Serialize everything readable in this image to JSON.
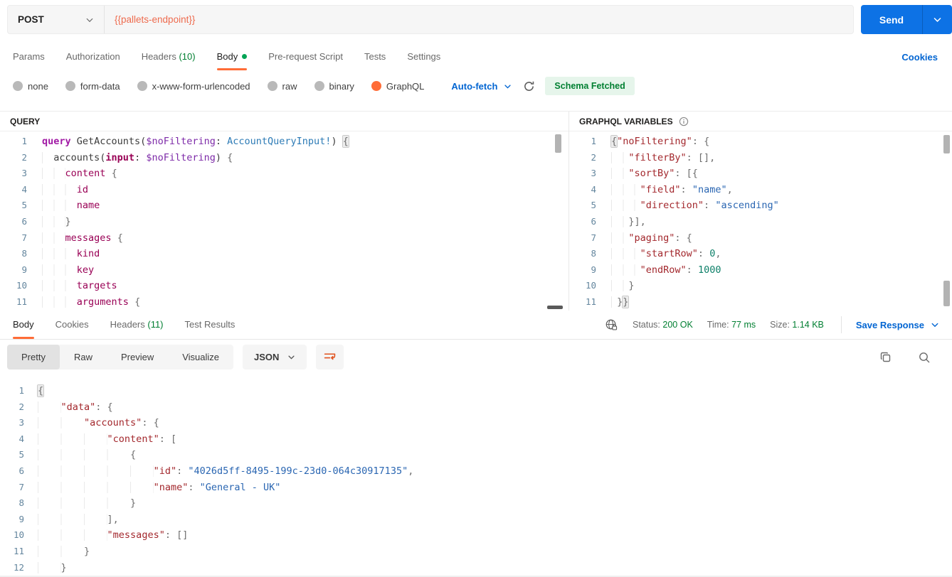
{
  "colors": {
    "accent_orange": "#FF6C37",
    "link_blue": "#0265D2",
    "send_blue": "#0D72E5",
    "status_green": "#007F31",
    "badge_green_bg": "#E6F5EB",
    "url_text": "#EE6B4E"
  },
  "request": {
    "method": "POST",
    "url": "{{pallets-endpoint}}",
    "send_label": "Send",
    "cookies_link": "Cookies",
    "tabs": [
      {
        "label": "Params"
      },
      {
        "label": "Authorization"
      },
      {
        "label": "Headers",
        "count": "(10)"
      },
      {
        "label": "Body",
        "active": true,
        "dot": true
      },
      {
        "label": "Pre-request Script"
      },
      {
        "label": "Tests"
      },
      {
        "label": "Settings"
      }
    ],
    "body_modes": [
      {
        "label": "none"
      },
      {
        "label": "form-data"
      },
      {
        "label": "x-www-form-urlencoded"
      },
      {
        "label": "raw"
      },
      {
        "label": "binary"
      },
      {
        "label": "GraphQL",
        "selected": true
      }
    ],
    "autofetch_label": "Auto-fetch",
    "schema_status": "Schema Fetched"
  },
  "query_panel": {
    "title": "QUERY",
    "lines": [
      [
        [
          "kw",
          "query"
        ],
        [
          "pl",
          " GetAccounts("
        ],
        [
          "vr",
          "$noFiltering"
        ],
        [
          "pl",
          ": "
        ],
        [
          "ty",
          "AccountQueryInput!"
        ],
        [
          "pl",
          ") "
        ],
        [
          "mb",
          "{"
        ]
      ],
      [
        [
          "in",
          "  "
        ],
        [
          "pl",
          "accounts("
        ],
        [
          "df",
          "input"
        ],
        [
          "pl",
          ": "
        ],
        [
          "vr",
          "$noFiltering"
        ],
        [
          "pl",
          ") "
        ],
        [
          "pc",
          "{"
        ]
      ],
      [
        [
          "in",
          "    "
        ],
        [
          "fd",
          "content"
        ],
        [
          "pl",
          " "
        ],
        [
          "pc",
          "{"
        ]
      ],
      [
        [
          "in",
          "      "
        ],
        [
          "fd",
          "id"
        ]
      ],
      [
        [
          "in",
          "      "
        ],
        [
          "fd",
          "name"
        ]
      ],
      [
        [
          "in",
          "    "
        ],
        [
          "pc",
          "}"
        ]
      ],
      [
        [
          "in",
          "    "
        ],
        [
          "fd",
          "messages"
        ],
        [
          "pl",
          " "
        ],
        [
          "pc",
          "{"
        ]
      ],
      [
        [
          "in",
          "      "
        ],
        [
          "fd",
          "kind"
        ]
      ],
      [
        [
          "in",
          "      "
        ],
        [
          "fd",
          "key"
        ]
      ],
      [
        [
          "in",
          "      "
        ],
        [
          "fd",
          "targets"
        ]
      ],
      [
        [
          "in",
          "      "
        ],
        [
          "fd",
          "arguments"
        ],
        [
          "pl",
          " "
        ],
        [
          "pc",
          "{"
        ]
      ]
    ]
  },
  "variables_panel": {
    "title": "GRAPHQL VARIABLES",
    "lines": [
      [
        [
          "mb",
          "{"
        ],
        [
          "ky",
          "\"noFiltering\""
        ],
        [
          "pc",
          ": {"
        ]
      ],
      [
        [
          "in",
          "   "
        ],
        [
          "ky",
          "\"filterBy\""
        ],
        [
          "pc",
          ": [],"
        ]
      ],
      [
        [
          "in",
          "   "
        ],
        [
          "ky",
          "\"sortBy\""
        ],
        [
          "pc",
          ": [{"
        ]
      ],
      [
        [
          "in",
          "     "
        ],
        [
          "ky",
          "\"field\""
        ],
        [
          "pc",
          ": "
        ],
        [
          "st",
          "\"name\""
        ],
        [
          "pc",
          ","
        ]
      ],
      [
        [
          "in",
          "     "
        ],
        [
          "ky",
          "\"direction\""
        ],
        [
          "pc",
          ": "
        ],
        [
          "st",
          "\"ascending\""
        ]
      ],
      [
        [
          "in",
          "   "
        ],
        [
          "pc",
          "}],"
        ]
      ],
      [
        [
          "in",
          "   "
        ],
        [
          "ky",
          "\"paging\""
        ],
        [
          "pc",
          ": {"
        ]
      ],
      [
        [
          "in",
          "     "
        ],
        [
          "ky",
          "\"startRow\""
        ],
        [
          "pc",
          ": "
        ],
        [
          "nm",
          "0"
        ],
        [
          "pc",
          ","
        ]
      ],
      [
        [
          "in",
          "     "
        ],
        [
          "ky",
          "\"endRow\""
        ],
        [
          "pc",
          ": "
        ],
        [
          "nm",
          "1000"
        ]
      ],
      [
        [
          "in",
          "   "
        ],
        [
          "pc",
          "}"
        ]
      ],
      [
        [
          "in",
          " "
        ],
        [
          "pc",
          "}"
        ],
        [
          "mb",
          "}"
        ]
      ]
    ]
  },
  "response": {
    "tabs": [
      {
        "label": "Body",
        "active": true
      },
      {
        "label": "Cookies"
      },
      {
        "label": "Headers",
        "count": "(11)"
      },
      {
        "label": "Test Results"
      }
    ],
    "status_label": "Status:",
    "status_value": "200 OK",
    "time_label": "Time:",
    "time_value": "77 ms",
    "size_label": "Size:",
    "size_value": "1.14 KB",
    "save_label": "Save Response",
    "view_tabs": [
      {
        "label": "Pretty",
        "active": true
      },
      {
        "label": "Raw"
      },
      {
        "label": "Preview"
      },
      {
        "label": "Visualize"
      }
    ],
    "language": "JSON",
    "body_lines": [
      [
        [
          "mb",
          "{"
        ]
      ],
      [
        [
          "in",
          "    "
        ],
        [
          "ky",
          "\"data\""
        ],
        [
          "pc",
          ": {"
        ]
      ],
      [
        [
          "in",
          "        "
        ],
        [
          "ky",
          "\"accounts\""
        ],
        [
          "pc",
          ": {"
        ]
      ],
      [
        [
          "in",
          "            "
        ],
        [
          "ky",
          "\"content\""
        ],
        [
          "pc",
          ": ["
        ]
      ],
      [
        [
          "in",
          "                "
        ],
        [
          "pc",
          "{"
        ]
      ],
      [
        [
          "in",
          "                    "
        ],
        [
          "ky",
          "\"id\""
        ],
        [
          "pc",
          ": "
        ],
        [
          "st",
          "\"4026d5ff-8495-199c-23d0-064c30917135\""
        ],
        [
          "pc",
          ","
        ]
      ],
      [
        [
          "in",
          "                    "
        ],
        [
          "ky",
          "\"name\""
        ],
        [
          "pc",
          ": "
        ],
        [
          "st",
          "\"General - UK\""
        ]
      ],
      [
        [
          "in",
          "                "
        ],
        [
          "pc",
          "}"
        ]
      ],
      [
        [
          "in",
          "            "
        ],
        [
          "pc",
          "],"
        ]
      ],
      [
        [
          "in",
          "            "
        ],
        [
          "ky",
          "\"messages\""
        ],
        [
          "pc",
          ": []"
        ]
      ],
      [
        [
          "in",
          "        "
        ],
        [
          "pc",
          "}"
        ]
      ],
      [
        [
          "in",
          "    "
        ],
        [
          "pc",
          "}"
        ]
      ]
    ]
  }
}
